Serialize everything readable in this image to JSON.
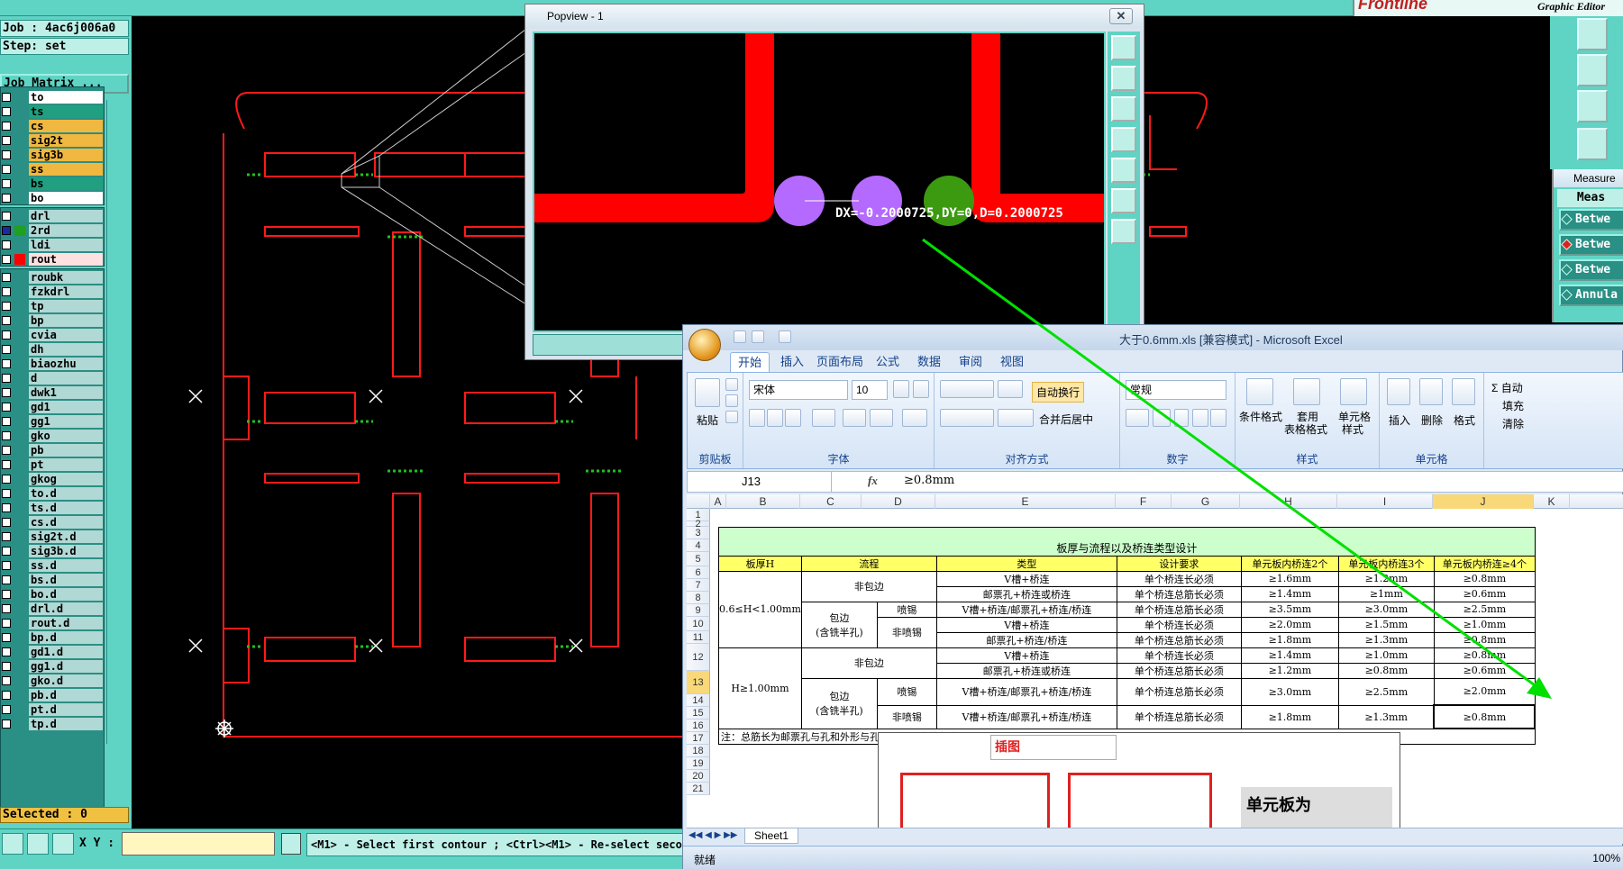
{
  "editor": {
    "brand": "Frontline",
    "brand_sub": "Graphic Editor",
    "job_line": "Job : 4ac6j006a0",
    "step_line": "Step: set",
    "job_matrix_btn": "Job Matrix ...",
    "selected_line": "Selected : 0",
    "xy_label": "X Y :",
    "status_message": "<M1> - Select first contour ; <Ctrl><M1> - Re-select second",
    "layers": [
      {
        "name": "to",
        "color": "#ffffff"
      },
      {
        "name": "ts",
        "color": "#20a080"
      },
      {
        "name": "cs",
        "color": "#f0b840"
      },
      {
        "name": "sig2t",
        "color": "#f0b840"
      },
      {
        "name": "sig3b",
        "color": "#f0b840"
      },
      {
        "name": "ss",
        "color": "#f0b840"
      },
      {
        "name": "bs",
        "color": "#20a080"
      },
      {
        "name": "bo",
        "color": "#ffffff"
      },
      {
        "name": "drl",
        "color": "#b0d8d4"
      },
      {
        "name": "2rd",
        "color": "#b0d8d4"
      },
      {
        "name": "ldi",
        "color": "#b0d8d4"
      },
      {
        "name": "rout",
        "color": "#ffe0e0"
      },
      {
        "name": "roubk",
        "color": "#b0d8d4"
      },
      {
        "name": "fzkdrl",
        "color": "#b0d8d4"
      },
      {
        "name": "tp",
        "color": "#b0d8d4"
      },
      {
        "name": "bp",
        "color": "#b0d8d4"
      },
      {
        "name": "cvia",
        "color": "#b0d8d4"
      },
      {
        "name": "dh",
        "color": "#b0d8d4"
      },
      {
        "name": "biaozhu",
        "color": "#b0d8d4"
      },
      {
        "name": "d",
        "color": "#b0d8d4"
      },
      {
        "name": "dwk1",
        "color": "#b0d8d4"
      },
      {
        "name": "gd1",
        "color": "#b0d8d4"
      },
      {
        "name": "gg1",
        "color": "#b0d8d4"
      },
      {
        "name": "gko",
        "color": "#b0d8d4"
      },
      {
        "name": "pb",
        "color": "#b0d8d4"
      },
      {
        "name": "pt",
        "color": "#b0d8d4"
      },
      {
        "name": "gkog",
        "color": "#b0d8d4"
      },
      {
        "name": "to.d",
        "color": "#b0d8d4"
      },
      {
        "name": "ts.d",
        "color": "#b0d8d4"
      },
      {
        "name": "cs.d",
        "color": "#b0d8d4"
      },
      {
        "name": "sig2t.d",
        "color": "#b0d8d4"
      },
      {
        "name": "sig3b.d",
        "color": "#b0d8d4"
      },
      {
        "name": "ss.d",
        "color": "#b0d8d4"
      },
      {
        "name": "bs.d",
        "color": "#b0d8d4"
      },
      {
        "name": "bo.d",
        "color": "#b0d8d4"
      },
      {
        "name": "drl.d",
        "color": "#b0d8d4"
      },
      {
        "name": "rout.d",
        "color": "#b0d8d4"
      },
      {
        "name": "bp.d",
        "color": "#b0d8d4"
      },
      {
        "name": "gd1.d",
        "color": "#b0d8d4"
      },
      {
        "name": "gg1.d",
        "color": "#b0d8d4"
      },
      {
        "name": "gko.d",
        "color": "#b0d8d4"
      },
      {
        "name": "pb.d",
        "color": "#b0d8d4"
      },
      {
        "name": "pt.d",
        "color": "#b0d8d4"
      },
      {
        "name": "tp.d",
        "color": "#b0d8d4"
      }
    ]
  },
  "popview": {
    "title": "Popview - 1",
    "measure_text": "DX=-0.2000725,DY=0,D=0.2000725"
  },
  "measure": {
    "title": "Measure",
    "header": "Meas",
    "items": [
      "Betwe",
      "Betwe",
      "Betwe",
      "Annula"
    ]
  },
  "excel": {
    "title": "大于0.6mm.xls [兼容模式] - Microsoft Excel",
    "tabs": [
      "开始",
      "插入",
      "页面布局",
      "公式",
      "数据",
      "审阅",
      "视图"
    ],
    "font_name": "宋体",
    "font_size": "10",
    "number_format": "常规",
    "wrap_text": "自动换行",
    "merge_center": "合并后居中",
    "paste": "粘贴",
    "cond_format": "条件格式",
    "table_format_1": "套用",
    "table_format_2": "表格格式",
    "cell_style_1": "单元格",
    "cell_style_2": "样式",
    "insert": "插入",
    "delete": "删除",
    "format": "格式",
    "autosum": "Σ 自动",
    "fill": "填充",
    "clear": "清除",
    "groups": [
      "剪贴板",
      "字体",
      "对齐方式",
      "数字",
      "样式",
      "单元格"
    ],
    "name_box": "J13",
    "fx": "fx",
    "formula_value": "≥0.8mm",
    "columns": [
      "A",
      "B",
      "C",
      "D",
      "E",
      "F",
      "G",
      "H",
      "I",
      "J",
      "K"
    ],
    "rows": [
      "1",
      "2",
      "3",
      "4",
      "5",
      "6",
      "7",
      "8",
      "9",
      "10",
      "11",
      "12",
      "13",
      "14",
      "15",
      "16",
      "17",
      "18",
      "19",
      "20",
      "21"
    ],
    "table": {
      "title": "板厚与流程以及桥连类型设计",
      "headers": [
        "板厚H",
        "流程",
        "类型",
        "设计要求",
        "单元板内桥连2个",
        "单元板内桥连3个",
        "单元板内桥连≥4个"
      ],
      "thick1": "0.6≤H<1.00mm",
      "thick2": "H≥1.00mm",
      "non_wrap": "非包边",
      "wrap": "包边\n(含铣半孔)",
      "spray": "喷锡",
      "non_spray": "非喷锡",
      "rows": [
        [
          "V槽+桥连",
          "单个桥连长必须",
          "≥1.6mm",
          "≥1.2mm",
          "≥0.8mm"
        ],
        [
          "邮票孔+桥连或桥连",
          "单个桥连总筋长必须",
          "≥1.4mm",
          "≥1mm",
          "≥0.6mm"
        ],
        [
          "V槽+桥连/邮票孔+桥连/桥连",
          "单个桥连总筋长必须",
          "≥3.5mm",
          "≥3.0mm",
          "≥2.5mm"
        ],
        [
          "V槽+桥连",
          "单个桥连长必须",
          "≥2.0mm",
          "≥1.5mm",
          "≥1.0mm"
        ],
        [
          "邮票孔+桥连/桥连",
          "单个桥连总筋长必须",
          "≥1.8mm",
          "≥1.3mm",
          "≥0.8mm"
        ],
        [
          "V槽+桥连",
          "单个桥连长必须",
          "≥1.4mm",
          "≥1.0mm",
          "≥0.8mm"
        ],
        [
          "邮票孔+桥连或桥连",
          "单个桥连总筋长必须",
          "≥1.2mm",
          "≥0.8mm",
          "≥0.6mm"
        ],
        [
          "V槽+桥连/邮票孔+桥连/桥连",
          "单个桥连总筋长必须",
          "≥3.0mm",
          "≥2.5mm",
          "≥2.0mm"
        ],
        [
          "V槽+桥连/邮票孔+桥连/桥连",
          "单个桥连总筋长必须",
          "≥1.8mm",
          "≥1.3mm",
          "≥0.8mm"
        ]
      ],
      "note": "注：总筋长为邮票孔与孔和外形与孔间距加起来的长度"
    },
    "picture_label": "插图",
    "picture_text": "单元板为",
    "sheet_tab": "Sheet1",
    "status": "就绪",
    "zoom": "100%"
  }
}
